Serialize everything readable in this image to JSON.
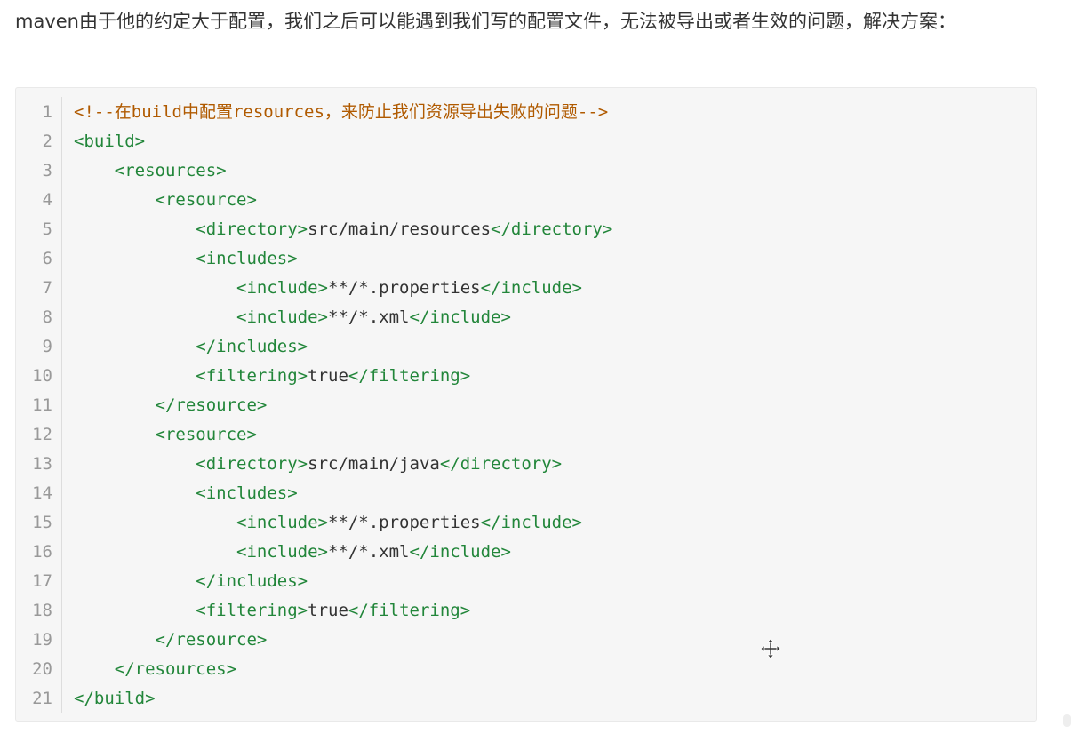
{
  "intro_text": "maven由于他的约定大于配置，我们之后可以能遇到我们写的配置文件，无法被导出或者生效的问题，解决方案：",
  "code": {
    "language": "xml",
    "lines": [
      {
        "n": "1",
        "tokens": [
          {
            "t": "comment",
            "v": "<!--在build中配置resources，来防止我们资源导出失败的问题-->"
          }
        ]
      },
      {
        "n": "2",
        "tokens": [
          {
            "t": "tag",
            "v": "<build>"
          }
        ]
      },
      {
        "n": "3",
        "tokens": [
          {
            "t": "text",
            "v": "    "
          },
          {
            "t": "tag",
            "v": "<resources>"
          }
        ]
      },
      {
        "n": "4",
        "tokens": [
          {
            "t": "text",
            "v": "        "
          },
          {
            "t": "tag",
            "v": "<resource>"
          }
        ]
      },
      {
        "n": "5",
        "tokens": [
          {
            "t": "text",
            "v": "            "
          },
          {
            "t": "tag",
            "v": "<directory>"
          },
          {
            "t": "text",
            "v": "src/main/resources"
          },
          {
            "t": "tag",
            "v": "</directory>"
          }
        ]
      },
      {
        "n": "6",
        "tokens": [
          {
            "t": "text",
            "v": "            "
          },
          {
            "t": "tag",
            "v": "<includes>"
          }
        ]
      },
      {
        "n": "7",
        "tokens": [
          {
            "t": "text",
            "v": "                "
          },
          {
            "t": "tag",
            "v": "<include>"
          },
          {
            "t": "text",
            "v": "**/*.properties"
          },
          {
            "t": "tag",
            "v": "</include>"
          }
        ]
      },
      {
        "n": "8",
        "tokens": [
          {
            "t": "text",
            "v": "                "
          },
          {
            "t": "tag",
            "v": "<include>"
          },
          {
            "t": "text",
            "v": "**/*.xml"
          },
          {
            "t": "tag",
            "v": "</include>"
          }
        ]
      },
      {
        "n": "9",
        "tokens": [
          {
            "t": "text",
            "v": "            "
          },
          {
            "t": "tag",
            "v": "</includes>"
          }
        ]
      },
      {
        "n": "10",
        "tokens": [
          {
            "t": "text",
            "v": "            "
          },
          {
            "t": "tag",
            "v": "<filtering>"
          },
          {
            "t": "text",
            "v": "true"
          },
          {
            "t": "tag",
            "v": "</filtering>"
          }
        ]
      },
      {
        "n": "11",
        "tokens": [
          {
            "t": "text",
            "v": "        "
          },
          {
            "t": "tag",
            "v": "</resource>"
          }
        ]
      },
      {
        "n": "12",
        "tokens": [
          {
            "t": "text",
            "v": "        "
          },
          {
            "t": "tag",
            "v": "<resource>"
          }
        ]
      },
      {
        "n": "13",
        "tokens": [
          {
            "t": "text",
            "v": "            "
          },
          {
            "t": "tag",
            "v": "<directory>"
          },
          {
            "t": "text",
            "v": "src/main/java"
          },
          {
            "t": "tag",
            "v": "</directory>"
          }
        ]
      },
      {
        "n": "14",
        "tokens": [
          {
            "t": "text",
            "v": "            "
          },
          {
            "t": "tag",
            "v": "<includes>"
          }
        ]
      },
      {
        "n": "15",
        "tokens": [
          {
            "t": "text",
            "v": "                "
          },
          {
            "t": "tag",
            "v": "<include>"
          },
          {
            "t": "text",
            "v": "**/*.properties"
          },
          {
            "t": "tag",
            "v": "</include>"
          }
        ]
      },
      {
        "n": "16",
        "tokens": [
          {
            "t": "text",
            "v": "                "
          },
          {
            "t": "tag",
            "v": "<include>"
          },
          {
            "t": "text",
            "v": "**/*.xml"
          },
          {
            "t": "tag",
            "v": "</include>"
          }
        ]
      },
      {
        "n": "17",
        "tokens": [
          {
            "t": "text",
            "v": "            "
          },
          {
            "t": "tag",
            "v": "</includes>"
          }
        ]
      },
      {
        "n": "18",
        "tokens": [
          {
            "t": "text",
            "v": "            "
          },
          {
            "t": "tag",
            "v": "<filtering>"
          },
          {
            "t": "text",
            "v": "true"
          },
          {
            "t": "tag",
            "v": "</filtering>"
          }
        ]
      },
      {
        "n": "19",
        "tokens": [
          {
            "t": "text",
            "v": "        "
          },
          {
            "t": "tag",
            "v": "</resource>"
          }
        ]
      },
      {
        "n": "20",
        "tokens": [
          {
            "t": "text",
            "v": "    "
          },
          {
            "t": "tag",
            "v": "</resources>"
          }
        ]
      },
      {
        "n": "21",
        "tokens": [
          {
            "t": "tag",
            "v": "</build>"
          }
        ]
      }
    ]
  },
  "colors": {
    "tag": "#22863a",
    "comment": "#b05a00",
    "text": "#333333",
    "line_number": "#999999",
    "code_background": "#f6f6f6"
  },
  "cursor_icon": "move-cursor-icon"
}
